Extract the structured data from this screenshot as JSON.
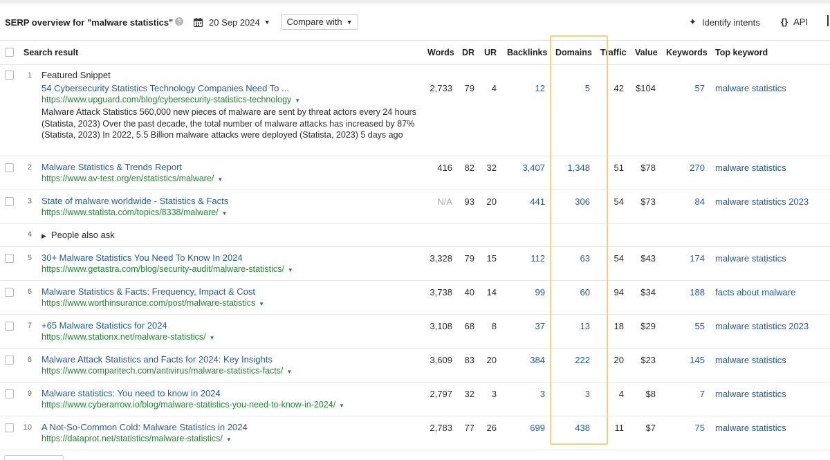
{
  "toolbar": {
    "title": "SERP overview for \"malware statistics\"",
    "date": "20 Sep 2024",
    "compare_label": "Compare with",
    "intents_label": "Identify intents",
    "api_label": "API"
  },
  "headers": {
    "search_result": "Search result",
    "words": "Words",
    "dr": "DR",
    "ur": "UR",
    "backlinks": "Backlinks",
    "domains": "Domains",
    "traffic": "Traffic",
    "value": "Value",
    "keywords": "Keywords",
    "top_keyword": "Top keyword"
  },
  "colors": {
    "link": "#1f5aa6",
    "url": "#1d8a2e",
    "highlight": "#f6cf7a"
  },
  "rows": [
    {
      "rank": "1",
      "label": "Featured Snippet",
      "title": "54 Cybersecurity Statistics Technology Companies Need To ...",
      "url": "https://www.upguard.com/blog/cybersecurity-statistics-technology",
      "snippet": "Malware Attack Statistics 560,000 new pieces of malware are sent by threat actors every 24 hours (Statista, 2023) Over the past decade, the total number of malware attacks has increased by 87% (Statista, 2023) In 2022, 5.5 Billion malware attacks were deployed (Statista, 2023) 5 days ago",
      "words": "2,733",
      "dr": "79",
      "ur": "4",
      "backlinks": "12",
      "domains": "5",
      "traffic": "42",
      "value": "$104",
      "keywords": "57",
      "top_keyword": "malware statistics"
    },
    {
      "rank": "2",
      "title": "Malware Statistics & Trends Report",
      "url": "https://www.av-test.org/en/statistics/malware/",
      "words": "416",
      "dr": "82",
      "ur": "32",
      "backlinks": "3,407",
      "domains": "1,348",
      "traffic": "51",
      "value": "$78",
      "keywords": "270",
      "top_keyword": "malware statistics"
    },
    {
      "rank": "3",
      "title": "State of malware worldwide - Statistics & Facts",
      "url": "https://www.statista.com/topics/8338/malware/",
      "words": "N/A",
      "dr": "93",
      "ur": "20",
      "backlinks": "441",
      "domains": "306",
      "traffic": "54",
      "value": "$73",
      "keywords": "84",
      "top_keyword": "malware statistics 2023"
    },
    {
      "rank": "4",
      "label": "People also ask"
    },
    {
      "rank": "5",
      "title": "30+ Malware Statistics You Need To Know In 2024",
      "url": "https://www.getastra.com/blog/security-audit/malware-statistics/",
      "words": "3,328",
      "dr": "79",
      "ur": "15",
      "backlinks": "112",
      "domains": "63",
      "traffic": "54",
      "value": "$43",
      "keywords": "174",
      "top_keyword": "malware statistics"
    },
    {
      "rank": "6",
      "title": "Malware Statistics & Facts: Frequency, Impact & Cost",
      "url": "https://www.worthinsurance.com/post/malware-statistics",
      "words": "3,738",
      "dr": "40",
      "ur": "14",
      "backlinks": "99",
      "domains": "60",
      "traffic": "94",
      "value": "$34",
      "keywords": "188",
      "top_keyword": "facts about malware"
    },
    {
      "rank": "7",
      "title": "+65 Malware Statistics for 2024",
      "url": "https://www.stationx.net/malware-statistics/",
      "words": "3,108",
      "dr": "68",
      "ur": "8",
      "backlinks": "37",
      "domains": "13",
      "traffic": "18",
      "value": "$29",
      "keywords": "55",
      "top_keyword": "malware statistics 2023"
    },
    {
      "rank": "8",
      "title": "Malware Attack Statistics and Facts for 2024: Key Insights",
      "url": "https://www.comparitech.com/antivirus/malware-statistics-facts/",
      "words": "3,609",
      "dr": "83",
      "ur": "20",
      "backlinks": "384",
      "domains": "222",
      "traffic": "20",
      "value": "$23",
      "keywords": "145",
      "top_keyword": "malware statistics"
    },
    {
      "rank": "9",
      "title": "Malware statistics: You need to know in 2024",
      "url": "https://www.cyberarrow.io/blog/malware-statistics-you-need-to-know-in-2024/",
      "words": "2,797",
      "dr": "32",
      "ur": "3",
      "backlinks": "3",
      "domains": "3",
      "traffic": "4",
      "value": "$8",
      "keywords": "7",
      "top_keyword": "malware statistics"
    },
    {
      "rank": "10",
      "title": "A Not-So-Common Cold: Malware Statistics in 2024",
      "url": "https://dataprot.net/statistics/malware-statistics/",
      "words": "2,783",
      "dr": "77",
      "ur": "26",
      "backlinks": "699",
      "domains": "438",
      "traffic": "11",
      "value": "$7",
      "keywords": "75",
      "top_keyword": "malware statistics"
    }
  ]
}
